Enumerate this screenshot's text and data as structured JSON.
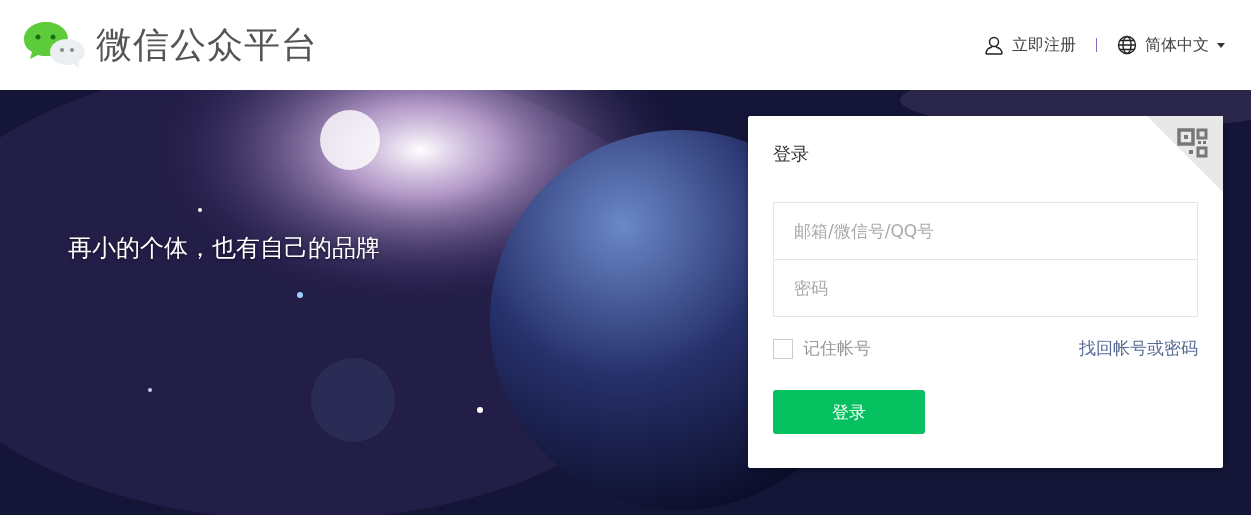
{
  "header": {
    "logo_text": "微信公众平台",
    "register_link": "立即注册",
    "language": "简体中文"
  },
  "hero": {
    "kind": "picture",
    "slogan": "再小的个体，也有自己的品牌"
  },
  "login": {
    "title": "登录",
    "account_field": {
      "placeholder": "邮箱/微信号/QQ号"
    },
    "password_field": {
      "placeholder": "密码"
    },
    "remember": {
      "label": "记住帐号",
      "checked": false
    },
    "forgot_link": "找回帐号或密码",
    "submit": "登录"
  }
}
